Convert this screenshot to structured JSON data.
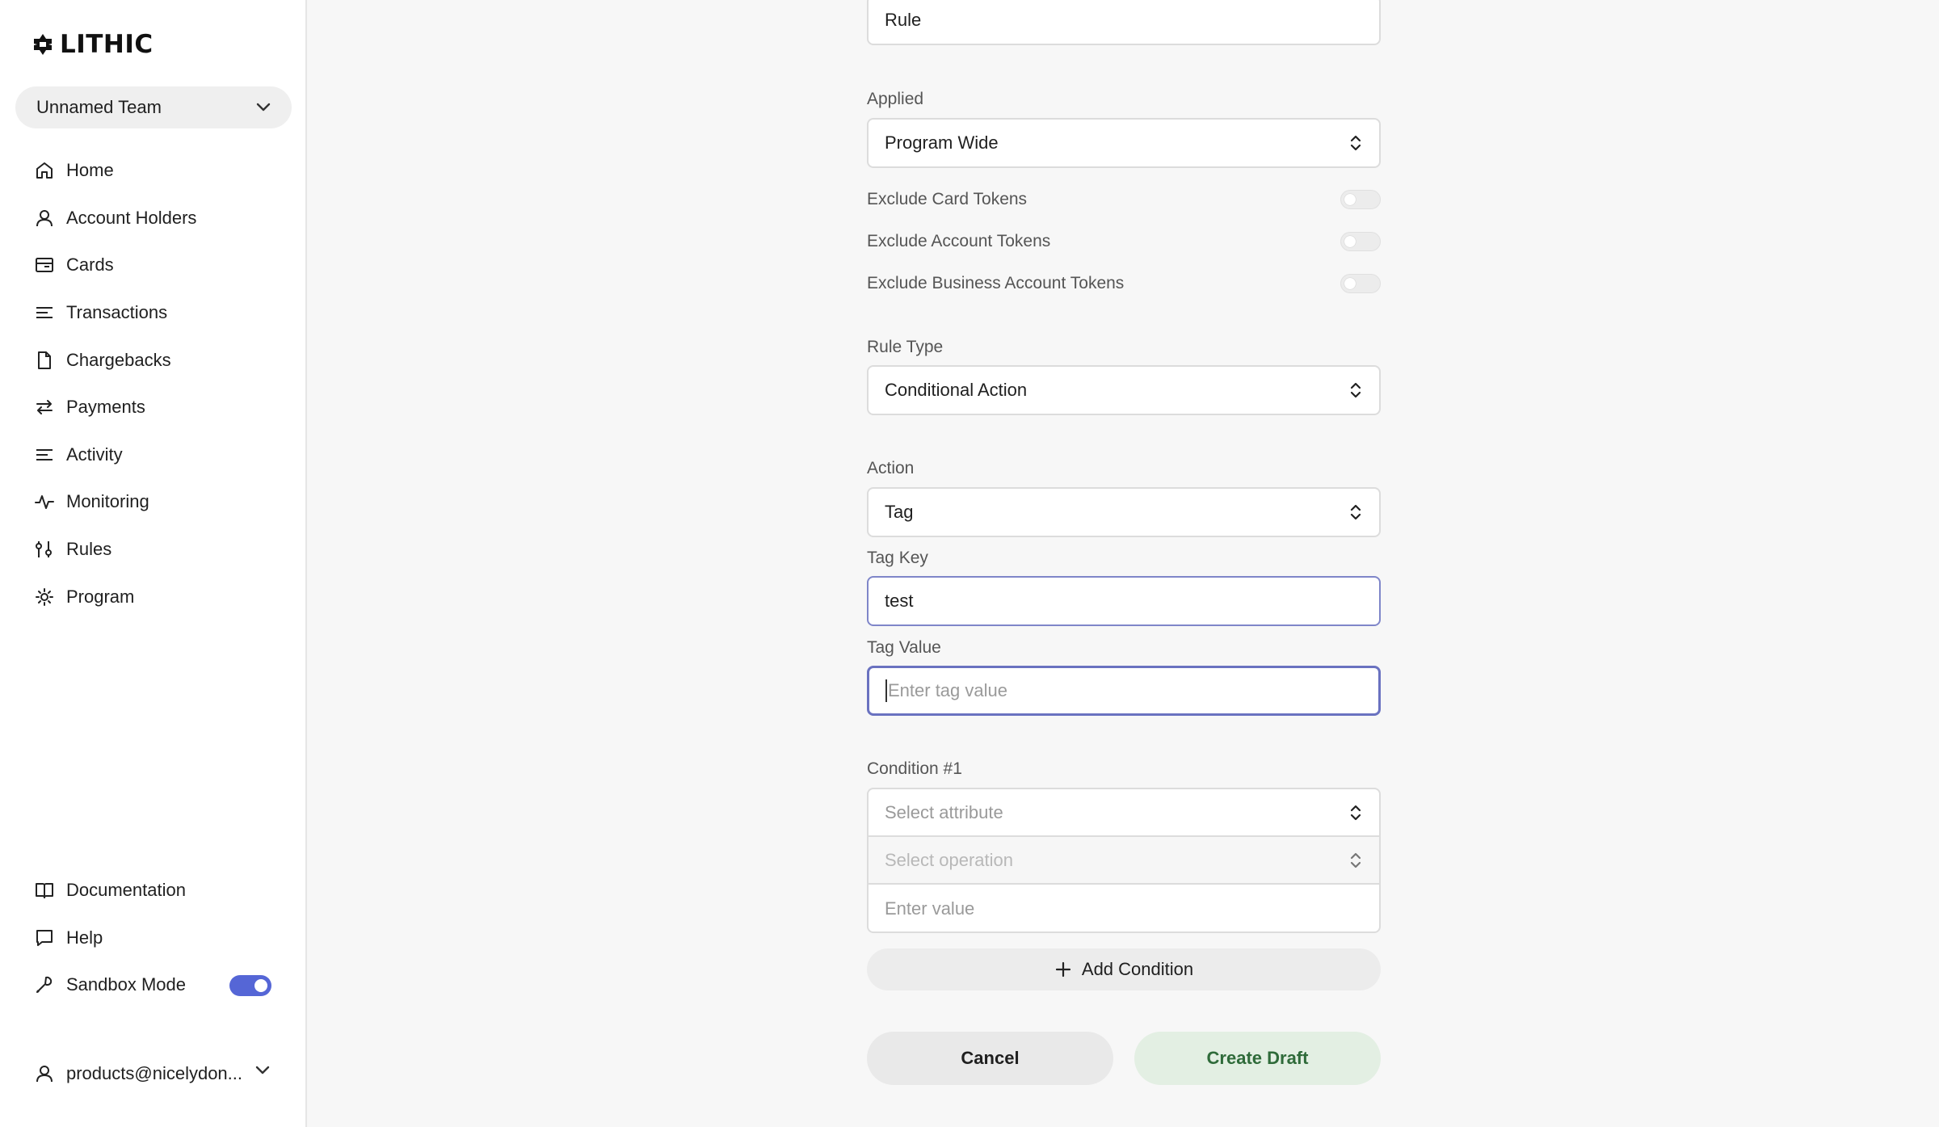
{
  "brand": {
    "name": "LITHIC",
    "accent": "#5566d6"
  },
  "team": {
    "name": "Unnamed Team"
  },
  "nav": {
    "items": [
      {
        "label": "Home",
        "icon": "home-icon"
      },
      {
        "label": "Account Holders",
        "icon": "user-icon"
      },
      {
        "label": "Cards",
        "icon": "card-icon"
      },
      {
        "label": "Transactions",
        "icon": "lines-icon"
      },
      {
        "label": "Chargebacks",
        "icon": "document-icon"
      },
      {
        "label": "Payments",
        "icon": "arrows-icon"
      },
      {
        "label": "Activity",
        "icon": "lines-icon"
      },
      {
        "label": "Monitoring",
        "icon": "pulse-icon"
      },
      {
        "label": "Rules",
        "icon": "sliders-icon"
      },
      {
        "label": "Program",
        "icon": "gear-icon"
      }
    ],
    "bottom": [
      {
        "label": "Documentation",
        "icon": "book-icon"
      },
      {
        "label": "Help",
        "icon": "chat-icon"
      },
      {
        "label": "Sandbox Mode",
        "icon": "wrench-icon",
        "toggle": true
      }
    ]
  },
  "user": {
    "email": "products@nicelydon..."
  },
  "form": {
    "name_value": "Rule",
    "applied": {
      "label": "Applied",
      "value": "Program Wide"
    },
    "toggles": [
      {
        "label": "Exclude Card Tokens",
        "on": false
      },
      {
        "label": "Exclude Account Tokens",
        "on": false
      },
      {
        "label": "Exclude Business Account Tokens",
        "on": false
      }
    ],
    "rule_type": {
      "label": "Rule Type",
      "value": "Conditional Action"
    },
    "action": {
      "label": "Action",
      "value": "Tag"
    },
    "tag_key": {
      "label": "Tag Key",
      "value": "test"
    },
    "tag_value": {
      "label": "Tag Value",
      "placeholder": "Enter tag value"
    },
    "condition": {
      "label": "Condition #1",
      "attribute_placeholder": "Select attribute",
      "operation_placeholder": "Select operation",
      "value_placeholder": "Enter value"
    },
    "add_condition_label": "Add Condition",
    "cancel_label": "Cancel",
    "create_label": "Create Draft"
  }
}
